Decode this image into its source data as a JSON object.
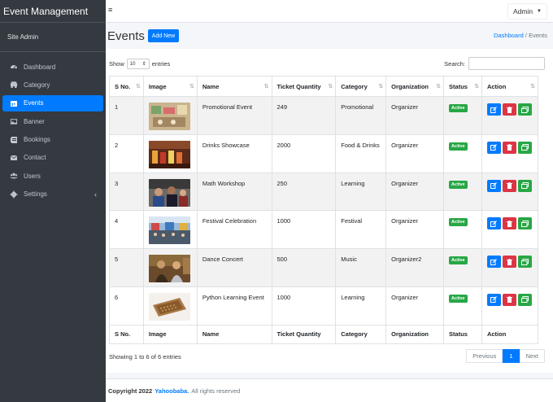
{
  "app": {
    "brand": "Event Management",
    "user": "Site Admin"
  },
  "sidebar": {
    "items": [
      {
        "label": "Dashboard",
        "icon": "dashboard-icon"
      },
      {
        "label": "Category",
        "icon": "category-icon"
      },
      {
        "label": "Events",
        "icon": "calendar-icon",
        "active": true
      },
      {
        "label": "Banner",
        "icon": "image-icon"
      },
      {
        "label": "Bookings",
        "icon": "bookings-icon"
      },
      {
        "label": "Contact",
        "icon": "contact-icon"
      },
      {
        "label": "Users",
        "icon": "users-icon"
      },
      {
        "label": "Settings",
        "icon": "gear-icon"
      }
    ]
  },
  "topbar": {
    "menu_icon": "≡",
    "admin_label": "Admin"
  },
  "header": {
    "title": "Events",
    "add_new": "Add New",
    "breadcrumb_home": "Dashboard",
    "breadcrumb_sep": "/",
    "breadcrumb_current": "Events"
  },
  "table_controls": {
    "show_label": "Show",
    "entries_value": "10",
    "entries_label": "entries",
    "search_label": "Search:"
  },
  "table": {
    "columns": [
      "S No.",
      "Image",
      "Name",
      "Ticket Quantity",
      "Category",
      "Organization",
      "Status",
      "Action"
    ],
    "rows": [
      {
        "sno": "1",
        "name": "Promotional Event",
        "qty": "249",
        "category": "Promotional",
        "org": "Organizer",
        "status": "Active"
      },
      {
        "sno": "2",
        "name": "Drinks Showcase",
        "qty": "2000",
        "category": "Food & Drinks",
        "org": "Organizer",
        "status": "Active"
      },
      {
        "sno": "3",
        "name": "Math Workshop",
        "qty": "250",
        "category": "Learning",
        "org": "Organizer",
        "status": "Active"
      },
      {
        "sno": "4",
        "name": "Festival Celebration",
        "qty": "1000",
        "category": "Festival",
        "org": "Organizer",
        "status": "Active"
      },
      {
        "sno": "5",
        "name": "Dance Concert",
        "qty": "500",
        "category": "Music",
        "org": "Organizer2",
        "status": "Active"
      },
      {
        "sno": "6",
        "name": "Python Learning Event",
        "qty": "1000",
        "category": "Learning",
        "org": "Organizer",
        "status": "Active"
      }
    ]
  },
  "pagination": {
    "info": "Showing 1 to 6 of 6 entries",
    "previous": "Previous",
    "current": "1",
    "next": "Next"
  },
  "footer": {
    "copyright": "Copyright 2022",
    "brand": "Yahoobaba.",
    "rights": "All rights reserved"
  },
  "colors": {
    "sidebar": "#343a40",
    "primary": "#007bff",
    "danger": "#dc3545",
    "success": "#28a745"
  }
}
